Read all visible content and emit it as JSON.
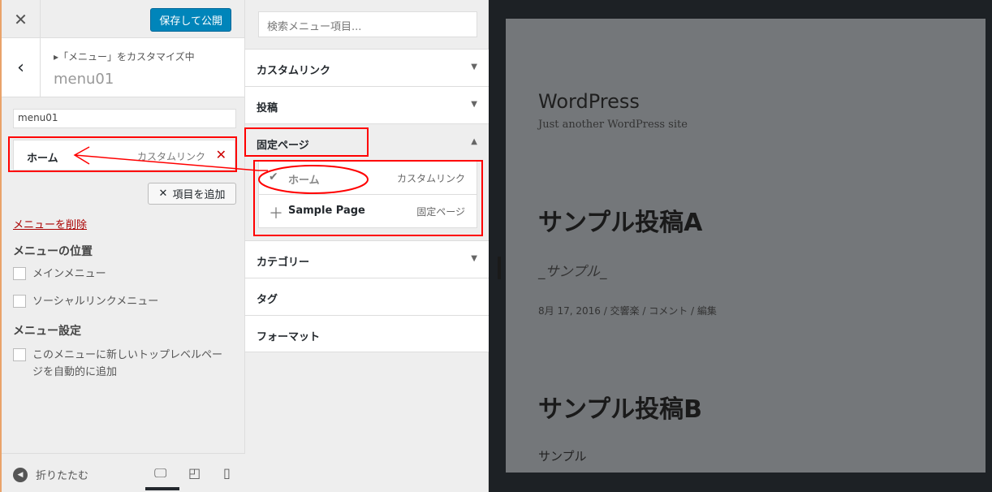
{
  "left": {
    "close_icon": "close-icon",
    "publish": "保存して公開",
    "breadcrumb": "▸「メニュー」をカスタマイズ中",
    "title": "menu01",
    "menu_name_value": "menu01",
    "menu_item": {
      "title": "ホーム",
      "type": "カスタムリンク"
    },
    "add_items": "項目を追加",
    "delete_menu": "メニューを削除",
    "locations_heading": "メニューの位置",
    "locations": [
      "メインメニュー",
      "ソーシャルリンクメニュー"
    ],
    "settings_heading": "メニュー設定",
    "auto_add": "このメニューに新しいトップレベルページを自動的に追加",
    "collapse": "折りたたむ",
    "device_selected": "desktop"
  },
  "mid": {
    "search_placeholder": "検索メニュー項目...",
    "sections": [
      "カスタムリンク",
      "投稿",
      "固定ページ",
      "カテゴリー",
      "タグ",
      "フォーマット"
    ],
    "open_section": "固定ページ",
    "available": [
      {
        "title": "ホーム",
        "type": "カスタムリンク",
        "state": "added"
      },
      {
        "title": "Sample Page",
        "type": "固定ページ",
        "state": "add"
      }
    ]
  },
  "preview": {
    "site_title": "WordPress",
    "tagline": "Just another WordPress site",
    "post1_title": "サンプル投稿A",
    "post1_excerpt": "_サンプル_",
    "post1_meta": "8月 17, 2016  /  交響楽  / コメント  /   編集",
    "post2_title": "サンプル投稿B",
    "post2_body": "サンプル"
  },
  "colors": {
    "accent": "#0085ba",
    "annotation": "#ff0000"
  }
}
